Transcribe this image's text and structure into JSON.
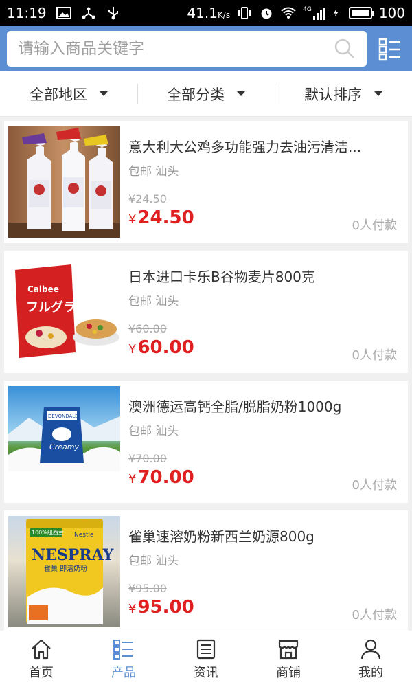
{
  "status_bar": {
    "time": "11:19",
    "speed": "41.1",
    "speed_unit": "K/s",
    "battery": "100",
    "signal_label": "4G"
  },
  "search": {
    "placeholder": "请输入商品关键字"
  },
  "filters": [
    {
      "label": "全部地区"
    },
    {
      "label": "全部分类"
    },
    {
      "label": "默认排序"
    }
  ],
  "products": [
    {
      "title": "意大利大公鸡多功能强力去油污清洁...",
      "shipping": "包邮",
      "location": "汕头",
      "old_price": "¥24.50",
      "price_symbol": "¥",
      "price": "24.50",
      "paid": "0人付款"
    },
    {
      "title": "日本进口卡乐B谷物麦片800克",
      "shipping": "包邮",
      "location": "汕头",
      "old_price": "¥60.00",
      "price_symbol": "¥",
      "price": "60.00",
      "paid": "0人付款"
    },
    {
      "title": "澳洲德运高钙全脂/脱脂奶粉1000g",
      "shipping": "包邮",
      "location": "汕头",
      "old_price": "¥70.00",
      "price_symbol": "¥",
      "price": "70.00",
      "paid": "0人付款"
    },
    {
      "title": "雀巢速溶奶粉新西兰奶源800g",
      "shipping": "包邮",
      "location": "汕头",
      "old_price": "¥95.00",
      "price_symbol": "¥",
      "price": "95.00",
      "paid": "0人付款"
    }
  ],
  "product_image_text": {
    "calbee_brand": "Calbee",
    "calbee_name": "フルグラ",
    "devondale_brand": "DEVONDALE",
    "devondale_name": "Creamy",
    "nespray_badge": "100%纽西兰",
    "nestle": "Nestle",
    "nespray": "NESPRAY",
    "nespray_sub": "雀巢 即溶奶粉"
  },
  "nav": [
    {
      "label": "首页",
      "icon": "home-icon",
      "active": false
    },
    {
      "label": "产品",
      "icon": "list-icon",
      "active": true
    },
    {
      "label": "资讯",
      "icon": "news-icon",
      "active": false
    },
    {
      "label": "商铺",
      "icon": "store-icon",
      "active": false
    },
    {
      "label": "我的",
      "icon": "user-icon",
      "active": false
    }
  ],
  "colors": {
    "header": "#5b8ed2",
    "price": "#e02020",
    "active_nav": "#5b8ed2"
  }
}
